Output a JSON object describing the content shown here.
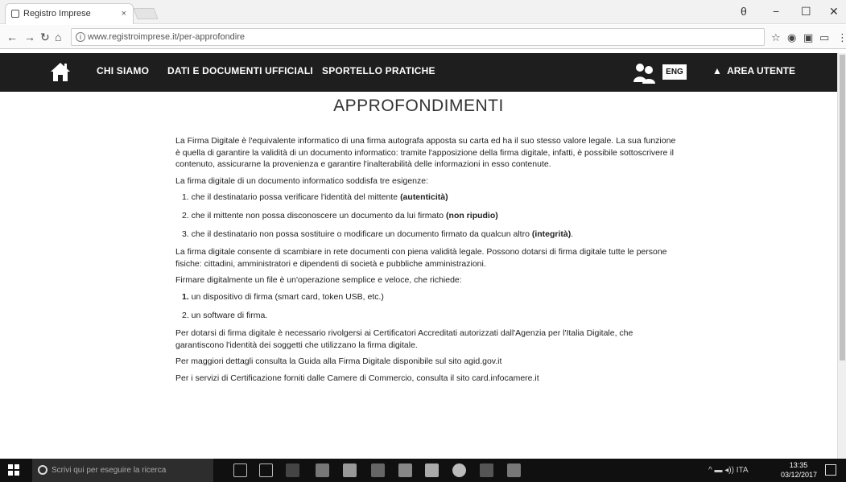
{
  "browser": {
    "tab_title": "Registro Imprese",
    "tab_close": "×",
    "url": "www.registroimprese.it/per-approfondire",
    "window": {
      "profile": "θ",
      "minimize": "−",
      "maximize": "☐",
      "close": "✕"
    }
  },
  "navbar": {
    "links": [
      "CHI SIAMO",
      "DATI E DOCUMENTI UFFICIALI",
      "SPORTELLO PRATICHE"
    ],
    "language": "ENG",
    "user_area": "AREA UTENTE"
  },
  "page": {
    "title": "APPROFONDIMENTI",
    "intro": "La Firma Digitale è l'equivalente informatico di una firma autografa apposta su carta ed ha il suo stesso valore legale. La sua funzione è quella di garantire la validità di un documento informatico: tramite l'apposizione della firma digitale, infatti, è possibile sottoscrivere il contenuto, assicurarne la provenienza e garantire l'inalterabilità delle informazioni in esso contenute.",
    "requirements_intro": "La firma digitale di un documento informatico soddisfa tre esigenze:",
    "requirements": [
      {
        "prefix": "1. che il destinatario possa verificare l'identità del mittente ",
        "bold": "(autenticità)",
        "suffix": ""
      },
      {
        "prefix": "2. che il mittente non possa disconoscere un documento da lui firmato ",
        "bold": "(non ripudio)",
        "suffix": ""
      },
      {
        "prefix": "3. che il destinatario non possa sostituire o modificare un documento firmato da qualcun altro ",
        "bold": "(integrità)",
        "suffix": "."
      }
    ],
    "exchange_text": "La firma digitale consente di scambiare in rete documenti con piena validità legale. Possono dotarsi di firma digitale tutte le persone fisiche: cittadini, amministratori e dipendenti di società e pubbliche amministrazioni.",
    "signing_intro": "Firmare digitalmente un file è un'operazione semplice e veloce, che richiede:",
    "signing_items": [
      {
        "number": "1.",
        "text": " un dispositivo di firma (smart card, token USB, etc.)"
      },
      {
        "number": "2.",
        "text": " un software di firma."
      }
    ],
    "certifiers_text": "Per dotarsi di firma digitale è necessario rivolgersi ai Certificatori Accreditati autorizzati dall'Agenzia per l'Italia Digitale, che garantiscono l'identità dei soggetti che utilizzano la firma digitale.",
    "more_info": "Per maggiori dettagli consulta la Guida alla Firma Digitale disponibile sul sito agid.gov.it",
    "cciaa_info": "Per i servizi di Certificazione forniti dalle Camere di Commercio, consulta il sito card.infocamere.it"
  },
  "taskbar": {
    "search_placeholder": "Scrivi qui per eseguire la ricerca",
    "language": "ITA",
    "time": "13:35",
    "date": "03/12/2017"
  }
}
